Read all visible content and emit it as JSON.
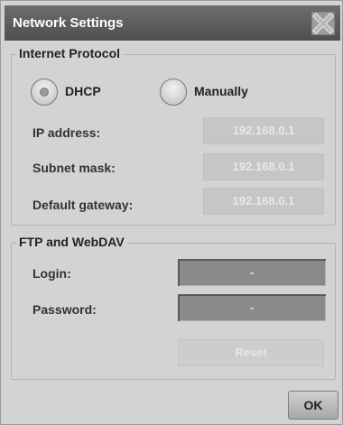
{
  "window": {
    "title": "Network Settings"
  },
  "internet_protocol": {
    "title": "Internet Protocol",
    "options": [
      {
        "label": "DHCP",
        "selected": true
      },
      {
        "label": "Manually",
        "selected": false
      }
    ],
    "fields": [
      {
        "label": "IP address:",
        "value": "192.168.0.1"
      },
      {
        "label": "Subnet mask:",
        "value": "192.168.0.1"
      },
      {
        "label": "Default gateway:",
        "value": "192.168.0.1"
      }
    ]
  },
  "ftp": {
    "title": "FTP and WebDAV",
    "login_label": "Login:",
    "login_value": "-",
    "password_label": "Password:",
    "password_value": "-",
    "reset_label": "Reset"
  },
  "ok_label": "OK",
  "icons": {
    "close": "close-icon",
    "radio": "radio-button-icon"
  }
}
